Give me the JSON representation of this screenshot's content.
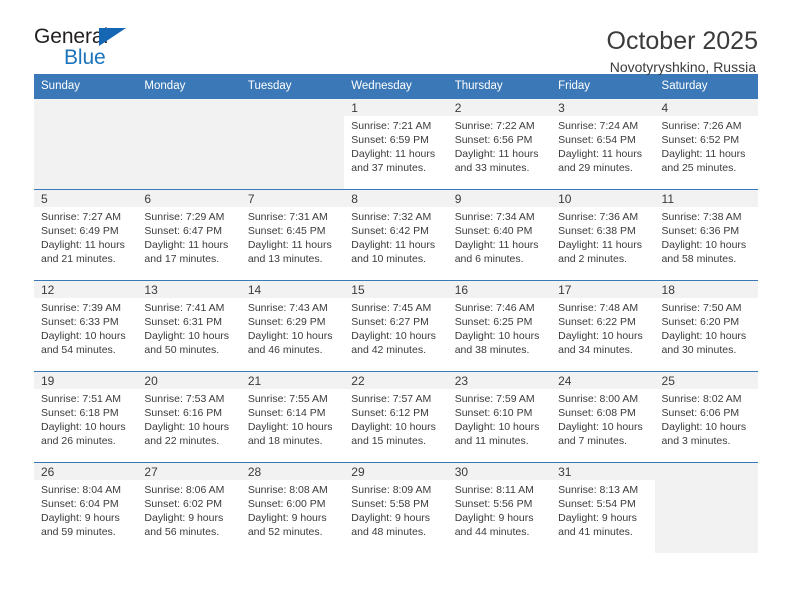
{
  "brand": {
    "name_primary": "General",
    "name_secondary": "Blue",
    "triangle_icon": "triangle-icon",
    "primary_color": "#231f20",
    "secondary_color": "#1c75bc"
  },
  "header": {
    "title": "October 2025",
    "subtitle": "Novotyryshkino, Russia"
  },
  "theme": {
    "header_bg": "#3b78b7",
    "cell_header_bg": "#f2f2f2",
    "text_color": "#3b3b3b"
  },
  "calendar": {
    "weekday_headers": [
      "Sunday",
      "Monday",
      "Tuesday",
      "Wednesday",
      "Thursday",
      "Friday",
      "Saturday"
    ],
    "weeks": [
      [
        {
          "day": "",
          "empty": true
        },
        {
          "day": "",
          "empty": true
        },
        {
          "day": "",
          "empty": true
        },
        {
          "day": "1",
          "sunrise": "Sunrise: 7:21 AM",
          "sunset": "Sunset: 6:59 PM",
          "daylight": "Daylight: 11 hours and 37 minutes."
        },
        {
          "day": "2",
          "sunrise": "Sunrise: 7:22 AM",
          "sunset": "Sunset: 6:56 PM",
          "daylight": "Daylight: 11 hours and 33 minutes."
        },
        {
          "day": "3",
          "sunrise": "Sunrise: 7:24 AM",
          "sunset": "Sunset: 6:54 PM",
          "daylight": "Daylight: 11 hours and 29 minutes."
        },
        {
          "day": "4",
          "sunrise": "Sunrise: 7:26 AM",
          "sunset": "Sunset: 6:52 PM",
          "daylight": "Daylight: 11 hours and 25 minutes."
        }
      ],
      [
        {
          "day": "5",
          "sunrise": "Sunrise: 7:27 AM",
          "sunset": "Sunset: 6:49 PM",
          "daylight": "Daylight: 11 hours and 21 minutes."
        },
        {
          "day": "6",
          "sunrise": "Sunrise: 7:29 AM",
          "sunset": "Sunset: 6:47 PM",
          "daylight": "Daylight: 11 hours and 17 minutes."
        },
        {
          "day": "7",
          "sunrise": "Sunrise: 7:31 AM",
          "sunset": "Sunset: 6:45 PM",
          "daylight": "Daylight: 11 hours and 13 minutes."
        },
        {
          "day": "8",
          "sunrise": "Sunrise: 7:32 AM",
          "sunset": "Sunset: 6:42 PM",
          "daylight": "Daylight: 11 hours and 10 minutes."
        },
        {
          "day": "9",
          "sunrise": "Sunrise: 7:34 AM",
          "sunset": "Sunset: 6:40 PM",
          "daylight": "Daylight: 11 hours and 6 minutes."
        },
        {
          "day": "10",
          "sunrise": "Sunrise: 7:36 AM",
          "sunset": "Sunset: 6:38 PM",
          "daylight": "Daylight: 11 hours and 2 minutes."
        },
        {
          "day": "11",
          "sunrise": "Sunrise: 7:38 AM",
          "sunset": "Sunset: 6:36 PM",
          "daylight": "Daylight: 10 hours and 58 minutes."
        }
      ],
      [
        {
          "day": "12",
          "sunrise": "Sunrise: 7:39 AM",
          "sunset": "Sunset: 6:33 PM",
          "daylight": "Daylight: 10 hours and 54 minutes."
        },
        {
          "day": "13",
          "sunrise": "Sunrise: 7:41 AM",
          "sunset": "Sunset: 6:31 PM",
          "daylight": "Daylight: 10 hours and 50 minutes."
        },
        {
          "day": "14",
          "sunrise": "Sunrise: 7:43 AM",
          "sunset": "Sunset: 6:29 PM",
          "daylight": "Daylight: 10 hours and 46 minutes."
        },
        {
          "day": "15",
          "sunrise": "Sunrise: 7:45 AM",
          "sunset": "Sunset: 6:27 PM",
          "daylight": "Daylight: 10 hours and 42 minutes."
        },
        {
          "day": "16",
          "sunrise": "Sunrise: 7:46 AM",
          "sunset": "Sunset: 6:25 PM",
          "daylight": "Daylight: 10 hours and 38 minutes."
        },
        {
          "day": "17",
          "sunrise": "Sunrise: 7:48 AM",
          "sunset": "Sunset: 6:22 PM",
          "daylight": "Daylight: 10 hours and 34 minutes."
        },
        {
          "day": "18",
          "sunrise": "Sunrise: 7:50 AM",
          "sunset": "Sunset: 6:20 PM",
          "daylight": "Daylight: 10 hours and 30 minutes."
        }
      ],
      [
        {
          "day": "19",
          "sunrise": "Sunrise: 7:51 AM",
          "sunset": "Sunset: 6:18 PM",
          "daylight": "Daylight: 10 hours and 26 minutes."
        },
        {
          "day": "20",
          "sunrise": "Sunrise: 7:53 AM",
          "sunset": "Sunset: 6:16 PM",
          "daylight": "Daylight: 10 hours and 22 minutes."
        },
        {
          "day": "21",
          "sunrise": "Sunrise: 7:55 AM",
          "sunset": "Sunset: 6:14 PM",
          "daylight": "Daylight: 10 hours and 18 minutes."
        },
        {
          "day": "22",
          "sunrise": "Sunrise: 7:57 AM",
          "sunset": "Sunset: 6:12 PM",
          "daylight": "Daylight: 10 hours and 15 minutes."
        },
        {
          "day": "23",
          "sunrise": "Sunrise: 7:59 AM",
          "sunset": "Sunset: 6:10 PM",
          "daylight": "Daylight: 10 hours and 11 minutes."
        },
        {
          "day": "24",
          "sunrise": "Sunrise: 8:00 AM",
          "sunset": "Sunset: 6:08 PM",
          "daylight": "Daylight: 10 hours and 7 minutes."
        },
        {
          "day": "25",
          "sunrise": "Sunrise: 8:02 AM",
          "sunset": "Sunset: 6:06 PM",
          "daylight": "Daylight: 10 hours and 3 minutes."
        }
      ],
      [
        {
          "day": "26",
          "sunrise": "Sunrise: 8:04 AM",
          "sunset": "Sunset: 6:04 PM",
          "daylight": "Daylight: 9 hours and 59 minutes."
        },
        {
          "day": "27",
          "sunrise": "Sunrise: 8:06 AM",
          "sunset": "Sunset: 6:02 PM",
          "daylight": "Daylight: 9 hours and 56 minutes."
        },
        {
          "day": "28",
          "sunrise": "Sunrise: 8:08 AM",
          "sunset": "Sunset: 6:00 PM",
          "daylight": "Daylight: 9 hours and 52 minutes."
        },
        {
          "day": "29",
          "sunrise": "Sunrise: 8:09 AM",
          "sunset": "Sunset: 5:58 PM",
          "daylight": "Daylight: 9 hours and 48 minutes."
        },
        {
          "day": "30",
          "sunrise": "Sunrise: 8:11 AM",
          "sunset": "Sunset: 5:56 PM",
          "daylight": "Daylight: 9 hours and 44 minutes."
        },
        {
          "day": "31",
          "sunrise": "Sunrise: 8:13 AM",
          "sunset": "Sunset: 5:54 PM",
          "daylight": "Daylight: 9 hours and 41 minutes."
        },
        {
          "day": "",
          "empty": true
        }
      ]
    ]
  }
}
